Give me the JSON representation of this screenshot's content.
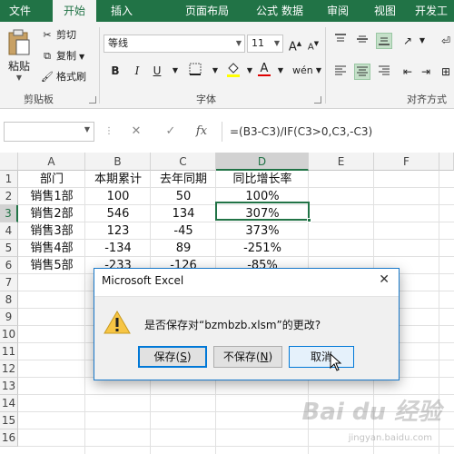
{
  "tabs": [
    {
      "label": "文件",
      "active": false
    },
    {
      "label": "开始",
      "active": true
    },
    {
      "label": "插入",
      "active": false
    },
    {
      "label": "页面布局",
      "active": false
    },
    {
      "label": "公式",
      "active": false
    },
    {
      "label": "数据",
      "active": false
    },
    {
      "label": "审阅",
      "active": false
    },
    {
      "label": "视图",
      "active": false
    },
    {
      "label": "开发工",
      "active": false
    }
  ],
  "ribbon": {
    "clipboard": {
      "paste_label": "粘贴",
      "cut_label": "剪切",
      "copy_label": "复制",
      "format_painter_label": "格式刷",
      "group_label": "剪贴板"
    },
    "font": {
      "font_name": "等线",
      "font_size": "11",
      "grow_label": "A",
      "shrink_label": "A",
      "bold": "B",
      "italic": "I",
      "underline": "U",
      "font_color": "A",
      "group_label": "字体"
    },
    "alignment": {
      "group_label": "对齐方式"
    },
    "accent_color": "#217346"
  },
  "formula_bar": {
    "fx_label": "fx",
    "formula": "=(B3-C3)/IF(C3>0,C3,-C3)"
  },
  "sheet": {
    "columns": [
      "A",
      "B",
      "C",
      "D",
      "E",
      "F"
    ],
    "selected_column": "D",
    "rows": [
      "1",
      "2",
      "3",
      "4",
      "5",
      "6",
      "7",
      "8",
      "9",
      "10",
      "11",
      "12",
      "13",
      "14",
      "15",
      "16"
    ],
    "selected_row": "3",
    "data": [
      [
        "部门",
        "本期累计",
        "去年同期",
        "同比增长率"
      ],
      [
        "销售1部",
        "100",
        "50",
        "100%"
      ],
      [
        "销售2部",
        "546",
        "134",
        "307%"
      ],
      [
        "销售3部",
        "123",
        "-45",
        "373%"
      ],
      [
        "销售4部",
        "-134",
        "89",
        "-251%"
      ],
      [
        "销售5部",
        "-233",
        "-126",
        "-85%"
      ]
    ]
  },
  "dialog": {
    "title": "Microsoft Excel",
    "message": "是否保存对“bzmbzb.xlsm”的更改?",
    "save_button": {
      "text": "保存(",
      "key": "S",
      "end": ")"
    },
    "dont_save_button": {
      "text": "不保存(",
      "key": "N",
      "end": ")"
    },
    "cancel_button": "取消",
    "warning_icon": "warning-icon"
  },
  "watermark": {
    "text": "Bai du 经验",
    "sub": "jingyan.baidu.com"
  }
}
